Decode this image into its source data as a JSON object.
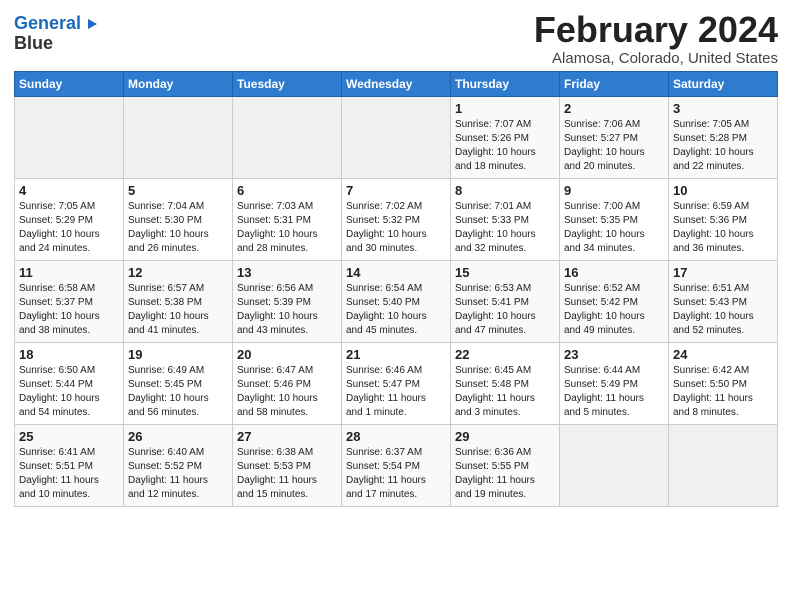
{
  "logo": {
    "line1": "General",
    "line2": "Blue"
  },
  "header": {
    "month": "February 2024",
    "location": "Alamosa, Colorado, United States"
  },
  "weekdays": [
    "Sunday",
    "Monday",
    "Tuesday",
    "Wednesday",
    "Thursday",
    "Friday",
    "Saturday"
  ],
  "weeks": [
    [
      {
        "day": "",
        "info": ""
      },
      {
        "day": "",
        "info": ""
      },
      {
        "day": "",
        "info": ""
      },
      {
        "day": "",
        "info": ""
      },
      {
        "day": "1",
        "info": "Sunrise: 7:07 AM\nSunset: 5:26 PM\nDaylight: 10 hours\nand 18 minutes."
      },
      {
        "day": "2",
        "info": "Sunrise: 7:06 AM\nSunset: 5:27 PM\nDaylight: 10 hours\nand 20 minutes."
      },
      {
        "day": "3",
        "info": "Sunrise: 7:05 AM\nSunset: 5:28 PM\nDaylight: 10 hours\nand 22 minutes."
      }
    ],
    [
      {
        "day": "4",
        "info": "Sunrise: 7:05 AM\nSunset: 5:29 PM\nDaylight: 10 hours\nand 24 minutes."
      },
      {
        "day": "5",
        "info": "Sunrise: 7:04 AM\nSunset: 5:30 PM\nDaylight: 10 hours\nand 26 minutes."
      },
      {
        "day": "6",
        "info": "Sunrise: 7:03 AM\nSunset: 5:31 PM\nDaylight: 10 hours\nand 28 minutes."
      },
      {
        "day": "7",
        "info": "Sunrise: 7:02 AM\nSunset: 5:32 PM\nDaylight: 10 hours\nand 30 minutes."
      },
      {
        "day": "8",
        "info": "Sunrise: 7:01 AM\nSunset: 5:33 PM\nDaylight: 10 hours\nand 32 minutes."
      },
      {
        "day": "9",
        "info": "Sunrise: 7:00 AM\nSunset: 5:35 PM\nDaylight: 10 hours\nand 34 minutes."
      },
      {
        "day": "10",
        "info": "Sunrise: 6:59 AM\nSunset: 5:36 PM\nDaylight: 10 hours\nand 36 minutes."
      }
    ],
    [
      {
        "day": "11",
        "info": "Sunrise: 6:58 AM\nSunset: 5:37 PM\nDaylight: 10 hours\nand 38 minutes."
      },
      {
        "day": "12",
        "info": "Sunrise: 6:57 AM\nSunset: 5:38 PM\nDaylight: 10 hours\nand 41 minutes."
      },
      {
        "day": "13",
        "info": "Sunrise: 6:56 AM\nSunset: 5:39 PM\nDaylight: 10 hours\nand 43 minutes."
      },
      {
        "day": "14",
        "info": "Sunrise: 6:54 AM\nSunset: 5:40 PM\nDaylight: 10 hours\nand 45 minutes."
      },
      {
        "day": "15",
        "info": "Sunrise: 6:53 AM\nSunset: 5:41 PM\nDaylight: 10 hours\nand 47 minutes."
      },
      {
        "day": "16",
        "info": "Sunrise: 6:52 AM\nSunset: 5:42 PM\nDaylight: 10 hours\nand 49 minutes."
      },
      {
        "day": "17",
        "info": "Sunrise: 6:51 AM\nSunset: 5:43 PM\nDaylight: 10 hours\nand 52 minutes."
      }
    ],
    [
      {
        "day": "18",
        "info": "Sunrise: 6:50 AM\nSunset: 5:44 PM\nDaylight: 10 hours\nand 54 minutes."
      },
      {
        "day": "19",
        "info": "Sunrise: 6:49 AM\nSunset: 5:45 PM\nDaylight: 10 hours\nand 56 minutes."
      },
      {
        "day": "20",
        "info": "Sunrise: 6:47 AM\nSunset: 5:46 PM\nDaylight: 10 hours\nand 58 minutes."
      },
      {
        "day": "21",
        "info": "Sunrise: 6:46 AM\nSunset: 5:47 PM\nDaylight: 11 hours\nand 1 minute."
      },
      {
        "day": "22",
        "info": "Sunrise: 6:45 AM\nSunset: 5:48 PM\nDaylight: 11 hours\nand 3 minutes."
      },
      {
        "day": "23",
        "info": "Sunrise: 6:44 AM\nSunset: 5:49 PM\nDaylight: 11 hours\nand 5 minutes."
      },
      {
        "day": "24",
        "info": "Sunrise: 6:42 AM\nSunset: 5:50 PM\nDaylight: 11 hours\nand 8 minutes."
      }
    ],
    [
      {
        "day": "25",
        "info": "Sunrise: 6:41 AM\nSunset: 5:51 PM\nDaylight: 11 hours\nand 10 minutes."
      },
      {
        "day": "26",
        "info": "Sunrise: 6:40 AM\nSunset: 5:52 PM\nDaylight: 11 hours\nand 12 minutes."
      },
      {
        "day": "27",
        "info": "Sunrise: 6:38 AM\nSunset: 5:53 PM\nDaylight: 11 hours\nand 15 minutes."
      },
      {
        "day": "28",
        "info": "Sunrise: 6:37 AM\nSunset: 5:54 PM\nDaylight: 11 hours\nand 17 minutes."
      },
      {
        "day": "29",
        "info": "Sunrise: 6:36 AM\nSunset: 5:55 PM\nDaylight: 11 hours\nand 19 minutes."
      },
      {
        "day": "",
        "info": ""
      },
      {
        "day": "",
        "info": ""
      }
    ]
  ]
}
